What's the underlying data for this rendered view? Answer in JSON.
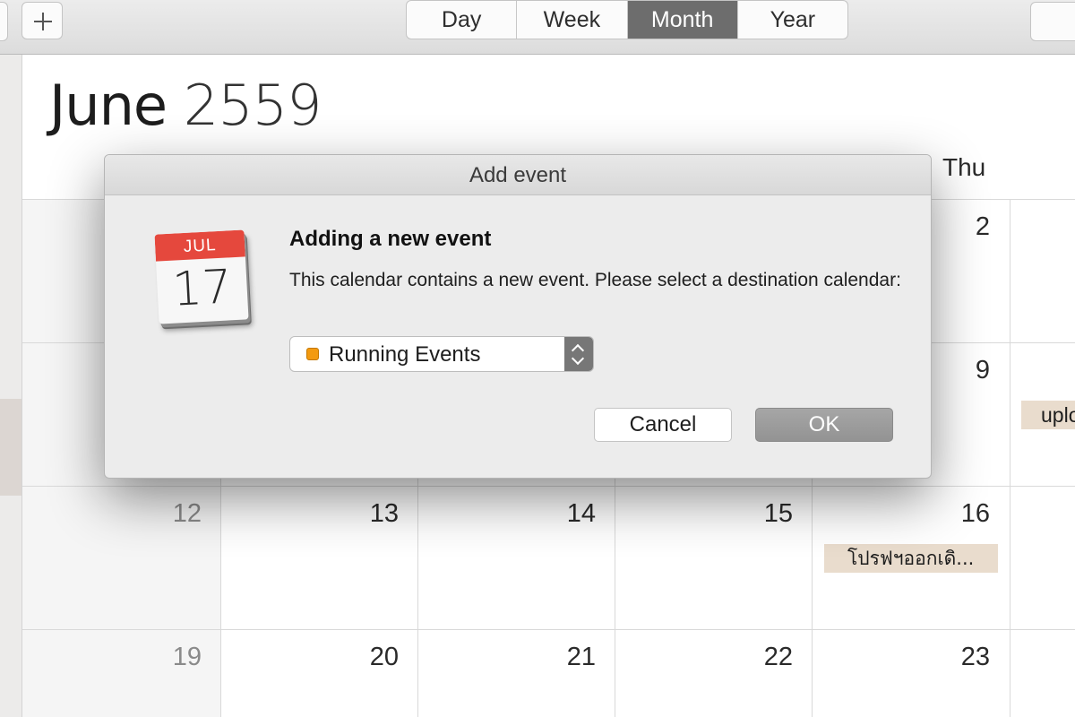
{
  "toolbar": {
    "add_icon": "plus-icon",
    "views": [
      "Day",
      "Week",
      "Month",
      "Year"
    ],
    "active_view": "Month"
  },
  "header": {
    "month": "June",
    "year": "2559",
    "visible_weekday": "Thu"
  },
  "calendar": {
    "day_numbers": {
      "row1_thu": "2",
      "row2_thu": "9",
      "row3": [
        "12",
        "13",
        "14",
        "15",
        "16"
      ],
      "row4": [
        "19",
        "20",
        "21",
        "22",
        "23"
      ]
    },
    "events": [
      {
        "label": "uplo",
        "color": "#e9dccd"
      },
      {
        "label": "โปรฟฯออกเดิ...",
        "color": "#e9dccd"
      }
    ]
  },
  "dialog": {
    "title": "Add event",
    "icon": "calendar-app-icon",
    "icon_month": "JUL",
    "icon_day": "17",
    "heading": "Adding a new event",
    "message": "This calendar contains a new event. Please select a destination calendar:",
    "destination_select": {
      "selected": "Running Events",
      "color": "#f39a10"
    },
    "cancel_label": "Cancel",
    "ok_label": "OK"
  }
}
